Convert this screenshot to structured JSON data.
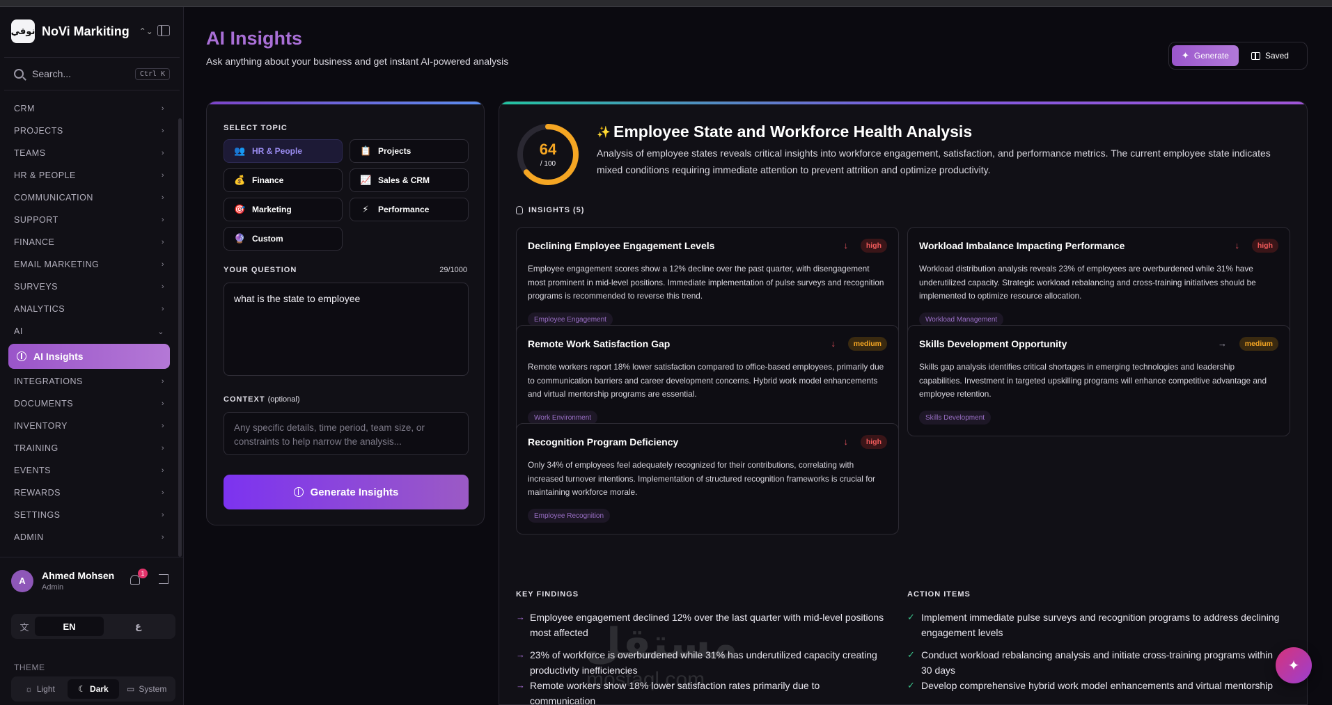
{
  "brand": {
    "logo_text": "نوفي",
    "name": "NoVi Markiting"
  },
  "search": {
    "placeholder": "Search...",
    "shortcut": "Ctrl K"
  },
  "nav": {
    "items_before": [
      "CRM",
      "PROJECTS",
      "TEAMS",
      "HR & PEOPLE",
      "COMMUNICATION",
      "SUPPORT",
      "FINANCE",
      "EMAIL MARKETING",
      "SURVEYS",
      "ANALYTICS",
      "AI"
    ],
    "active_item": "AI Insights",
    "items_after": [
      "INTEGRATIONS",
      "DOCUMENTS",
      "INVENTORY",
      "TRAINING",
      "EVENTS",
      "REWARDS",
      "SETTINGS",
      "ADMIN"
    ]
  },
  "user": {
    "initial": "A",
    "name": "Ahmed Mohsen",
    "role": "Admin",
    "notifications": "1"
  },
  "language": {
    "options": [
      "EN",
      "ع"
    ],
    "selected": "EN"
  },
  "theme": {
    "label": "THEME",
    "options": [
      "Light",
      "Dark",
      "System"
    ],
    "selected": "Dark"
  },
  "header": {
    "title": "AI Insights",
    "subtitle": "Ask anything about your business and get instant AI-powered analysis"
  },
  "mode": {
    "generate": "Generate",
    "saved": "Saved",
    "selected": "Generate"
  },
  "form": {
    "topic_label": "SELECT TOPIC",
    "topics": [
      {
        "label": "HR & People",
        "icon": "people-icon",
        "glyph": "👥"
      },
      {
        "label": "Projects",
        "icon": "clipboard-icon",
        "glyph": "📋"
      },
      {
        "label": "Finance",
        "icon": "money-bag-icon",
        "glyph": "💰"
      },
      {
        "label": "Sales & CRM",
        "icon": "chart-icon",
        "glyph": "📈"
      },
      {
        "label": "Marketing",
        "icon": "target-icon",
        "glyph": "🎯"
      },
      {
        "label": "Performance",
        "icon": "lightning-icon",
        "glyph": "⚡"
      },
      {
        "label": "Custom",
        "icon": "crystal-ball-icon",
        "glyph": "🔮"
      }
    ],
    "selected_topic": "HR & People",
    "question_label": "YOUR QUESTION",
    "char_count": "29/1000",
    "question_value": "what is the state to employee",
    "context_label": "CONTEXT",
    "context_optional": "(optional)",
    "context_placeholder": "Any specific details, time period, team size, or constraints to help narrow the analysis...",
    "submit_label": "Generate Insights"
  },
  "analysis": {
    "score": 64,
    "score_max": "/ 100",
    "title": "Employee State and Workforce Health Analysis",
    "summary": "Analysis of employee states reveals critical insights into workforce engagement, satisfaction, and performance metrics. The current employee state indicates mixed conditions requiring immediate attention to prevent attrition and optimize productivity.",
    "insights_heading": "INSIGHTS (5)",
    "insights": [
      {
        "title": "Declining Employee Engagement Levels",
        "trend": "↓",
        "severity": "high",
        "body": "Employee engagement scores show a 12% decline over the past quarter, with disengagement most prominent in mid-level positions. Immediate implementation of pulse surveys and recognition programs is recommended to reverse this trend.",
        "tag": "Employee Engagement"
      },
      {
        "title": "Workload Imbalance Impacting Performance",
        "trend": "↓",
        "severity": "high",
        "body": "Workload distribution analysis reveals 23% of employees are overburdened while 31% have underutilized capacity. Strategic workload rebalancing and cross-training initiatives should be implemented to optimize resource allocation.",
        "tag": "Workload Management"
      },
      {
        "title": "Remote Work Satisfaction Gap",
        "trend": "↓",
        "severity": "medium",
        "body": "Remote workers report 18% lower satisfaction compared to office-based employees, primarily due to communication barriers and career development concerns. Hybrid work model enhancements and virtual mentorship programs are essential.",
        "tag": "Work Environment"
      },
      {
        "title": "Skills Development Opportunity",
        "trend": "→",
        "severity": "medium",
        "body": "Skills gap analysis identifies critical shortages in emerging technologies and leadership capabilities. Investment in targeted upskilling programs will enhance competitive advantage and employee retention.",
        "tag": "Skills Development"
      },
      {
        "title": "Recognition Program Deficiency",
        "trend": "↓",
        "severity": "high",
        "body": "Only 34% of employees feel adequately recognized for their contributions, correlating with increased turnover intentions. Implementation of structured recognition frameworks is crucial for maintaining workforce morale.",
        "tag": "Employee Recognition"
      }
    ],
    "findings_label": "KEY FINDINGS",
    "findings": [
      "Employee engagement declined 12% over the last quarter with mid-level positions most affected",
      "23% of workforce is overburdened while 31% has underutilized capacity creating productivity inefficiencies",
      "Remote workers show 18% lower satisfaction rates primarily due to communication"
    ],
    "actions_label": "ACTION ITEMS",
    "actions": [
      "Implement immediate pulse surveys and recognition programs to address declining engagement levels",
      "Conduct workload rebalancing analysis and initiate cross-training programs within 30 days",
      "Develop comprehensive hybrid work model enhancements and virtual mentorship"
    ]
  },
  "watermark": {
    "main": "مستقل",
    "sub": "mostaql.com"
  }
}
